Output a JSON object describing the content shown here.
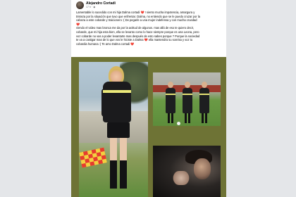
{
  "post": {
    "author": "Alejandro Cortadi",
    "timestamp": "17 h",
    "privacy_icon": "globe-icon",
    "lines": [
      "Lamentable lo sucedido con mi hija Dalma cortadi ❤️ ! siento mucha impotencia, amargura y",
      "tristeza por la situación que tuvo que enfrentar. Dalma, no entiendo que se le puedo cruzar por la",
      "cabeza a este cobarde y traicionero :( De pegarle a una mujer indefensa y con mucha cruedad",
      "❤️",
      "viendo el video mas bronca me da por la actitud de algunos. mas allá de eso te quiero decir,",
      "cobarde, que mi hija esta bien, ella se levanto como lo hace siempre porque es una Leona, pero",
      "voz cobarde no vas a poder levantarte mas después de esto sabes porque ? Porque la sociedad",
      "te va a castigar mas de lo que vos le hiciste a Dalma ❤️ ella mantendra su sonrisa y voz tu",
      "cobardia humana :( Te amo Dalma cortadi ❤️"
    ]
  },
  "photos": {
    "left": "referee-portrait-photo",
    "right_top": "referees-on-field-photo",
    "right_bottom": "crying-referee-photo"
  },
  "colors": {
    "grid_background": "#6e7335",
    "heart": "#e0245e"
  }
}
